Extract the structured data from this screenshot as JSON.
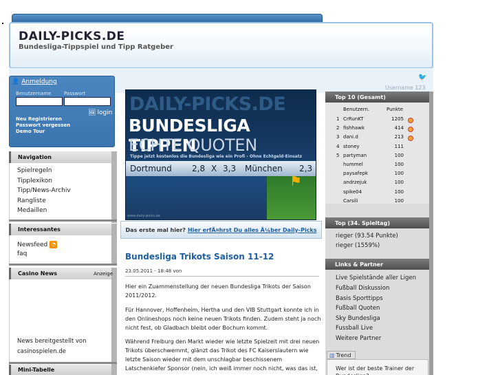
{
  "header": {
    "title": "DAILY-PICKS.DE",
    "subtitle": "Bundesliga-Tippspiel und Tipp Ratgeber",
    "username_watermark": "Username 123"
  },
  "login": {
    "tab": "Anmeldung",
    "user_label": "Benutzername",
    "pass_label": "Passwort",
    "button": "login",
    "links": [
      "Neu Registrieren",
      "Passwort vergessen",
      "Demo Tour"
    ]
  },
  "navigation": {
    "title": "Navigation",
    "items": [
      "Spielregeln",
      "Tipplexikon",
      "Tipp/News-Archiv",
      "Rangliste",
      "Medaillen"
    ]
  },
  "interessantes": {
    "title": "Interessantes",
    "items": [
      "Newsfeed",
      "faq"
    ]
  },
  "casino": {
    "title": "Casino News",
    "badge": "Anzeige",
    "footer_line1": "News bereitgestellt von",
    "footer_line2": "casinospielen.de"
  },
  "mini_tabelle": {
    "title": "Mini-Tabelle"
  },
  "banner": {
    "line1": "DAILY-PICKS.DE",
    "line2": "BUNDESLIGA TIPPEN",
    "line3": "ECHTE QUOTEN",
    "tagline": "Tippe jetzt kostenlos die Bundesliga wie ein Profi - Ohne Echtgeld-Einsatz",
    "home": "Dortmund",
    "home_odds": "2,8",
    "draw": "X",
    "draw_odds": "3,3",
    "away": "München",
    "away_odds": "2,3",
    "foot": "www.daily-picks.de"
  },
  "firsttime": {
    "text": "Das erste mal hier?",
    "link": "Hier erfÃ¤hrst Du alles Ã¼ber Daily-Picks"
  },
  "article": {
    "title": "Bundesliga Trikots Saison 11-12",
    "date": "23.05.2011 - 18:48 von",
    "p1": "Hier ein Zuammenstellung der neuen Bundesliga Trikots der Saison 2011/2012.",
    "p2": "Für Hannover, Hoffenheim, Hertha und den VIB Stuttgart konnte ich in den Onlineshops noch keine neuen Trikots finden. Zudem steht ja noch nicht fest, ob Gladbach bleibt oder Bochum kommt.",
    "p3": "Während Freiburg den Markt wieder wie letzte Spielzeit mit drei neuen Trikots überschwemmt, glänzt das Trikot des FC Kaiserslautern wie letzte Saison wieder mit dem unschlagbar beschissenem Latschenkiefer Sponsor (nein, ich weiß immer noch nicht, was das ist, und ich will es auch gar nicht wissen)."
  },
  "top10": {
    "title": "Top 10 (Gesamt)",
    "col_user": "Benutzern.",
    "col_points": "Punkte",
    "rows": [
      {
        "rank": "1",
        "name": "CrRunKT",
        "points": "1205"
      },
      {
        "rank": "2",
        "name": "fishhawk",
        "points": "414"
      },
      {
        "rank": "3",
        "name": "dani.d",
        "points": "213"
      },
      {
        "rank": "4",
        "name": "stoney",
        "points": "111"
      },
      {
        "rank": "5",
        "name": "partyman",
        "points": "100"
      },
      {
        "rank": "",
        "name": "hummel",
        "points": "100"
      },
      {
        "rank": "",
        "name": "paysafepk",
        "points": "100"
      },
      {
        "rank": "",
        "name": "andrzejuk",
        "points": "100"
      },
      {
        "rank": "",
        "name": "spike04",
        "points": "100"
      },
      {
        "rank": "",
        "name": "Carsili",
        "points": "100"
      }
    ]
  },
  "top_spieltag": {
    "title": "Top (34. Spieltag)",
    "items": [
      "rieger (93.54 Punkte)",
      "rieger (1559%)"
    ]
  },
  "links": {
    "title": "Links & Partner",
    "items": [
      "Live Spielstände aller Ligen",
      "Fußball Diskussion",
      "Basis Sporttipps",
      "Fußball Quoten",
      "Sky Bundesliga",
      "Fussball Live",
      "Weitere Partner"
    ]
  },
  "trend": {
    "tab": "Trend",
    "text": "Wer ist der beste Trainer der Bundesliga?"
  }
}
